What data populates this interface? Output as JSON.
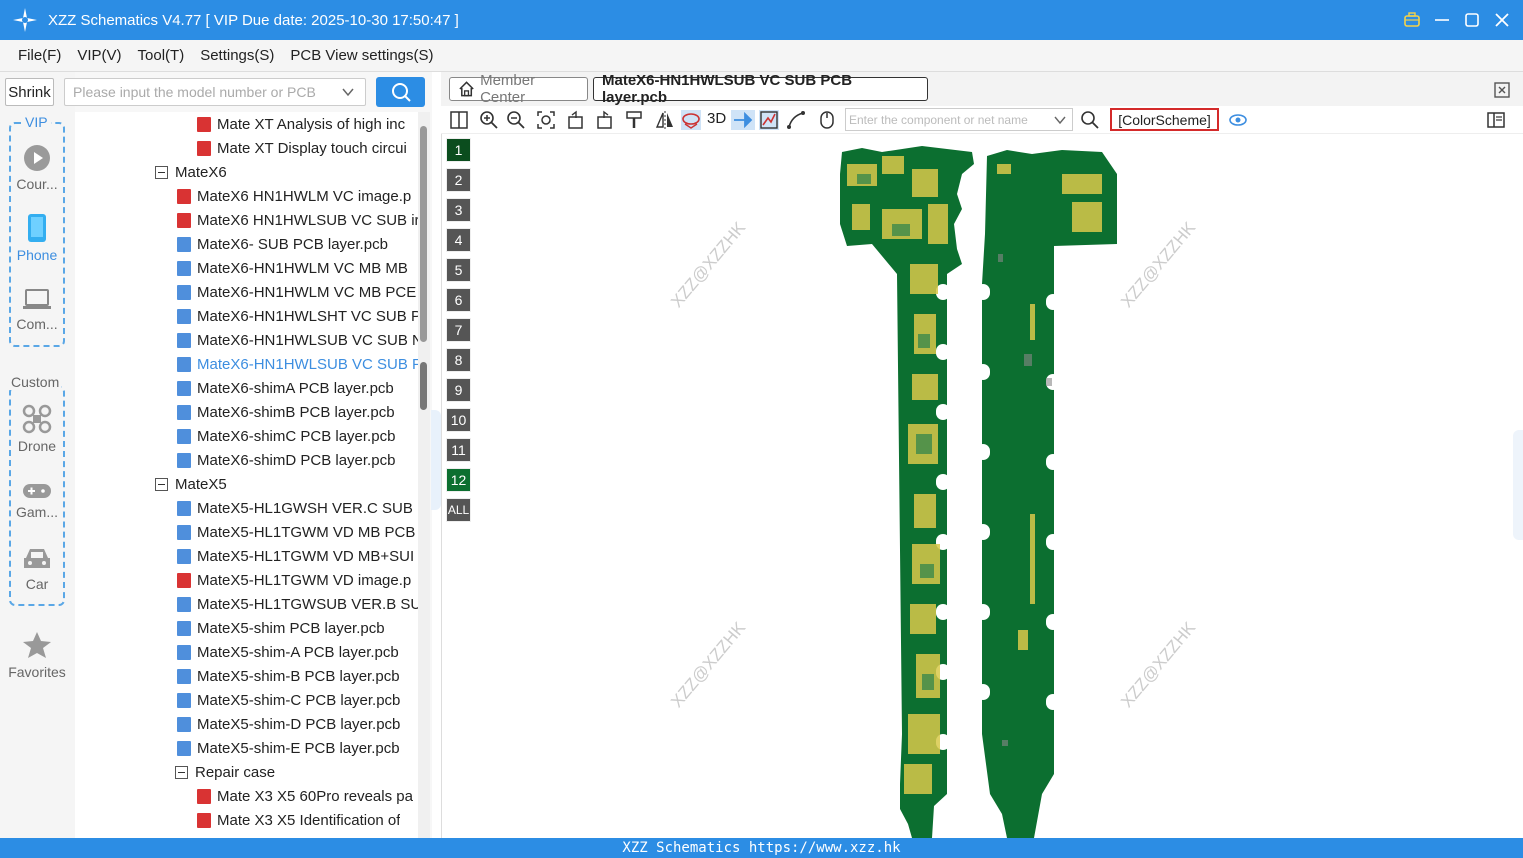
{
  "titlebar": {
    "title": "XZZ Schematics V4.77 [ VIP Due date: 2025-10-30 17:50:47 ]"
  },
  "menu": [
    "File(F)",
    "VIP(V)",
    "Tool(T)",
    "Settings(S)",
    "PCB View settings(S)"
  ],
  "left": {
    "shrink_label": "Shrink",
    "search_placeholder": "Please input the model number or PCB"
  },
  "sidebar": {
    "vip_label": "VIP",
    "custom_label": "Custom",
    "items": [
      {
        "label": "Cour...",
        "icon": "play-icon"
      },
      {
        "label": "Phone",
        "icon": "phone-icon"
      },
      {
        "label": "Com...",
        "icon": "laptop-icon"
      },
      {
        "label": "Drone",
        "icon": "drone-icon"
      },
      {
        "label": "Gam...",
        "icon": "gamepad-icon"
      },
      {
        "label": "Car",
        "icon": "car-icon"
      },
      {
        "label": "Favorites",
        "icon": "star-icon"
      }
    ]
  },
  "tree": [
    {
      "label": "Mate XT Analysis of high inc",
      "type": "pdf",
      "level": 2
    },
    {
      "label": "Mate XT Display touch circui",
      "type": "pdf",
      "level": 2
    },
    {
      "label": "MateX6",
      "type": "folder",
      "level": 0
    },
    {
      "label": "MateX6 HN1HWLM VC image.p",
      "type": "pdf",
      "level": 1
    },
    {
      "label": "MateX6 HN1HWLSUB VC SUB ir",
      "type": "pdf",
      "level": 1
    },
    {
      "label": "MateX6- SUB PCB layer.pcb",
      "type": "pcb",
      "level": 1
    },
    {
      "label": "MateX6-HN1HWLM VC MB MB",
      "type": "pcb",
      "level": 1
    },
    {
      "label": "MateX6-HN1HWLM VC MB PCE",
      "type": "pcb",
      "level": 1
    },
    {
      "label": "MateX6-HN1HWLSHT VC SUB P",
      "type": "pcb",
      "level": 1
    },
    {
      "label": "MateX6-HN1HWLSUB VC SUB N",
      "type": "pcb",
      "level": 1
    },
    {
      "label": "MateX6-HN1HWLSUB VC SUB P",
      "type": "pcb",
      "level": 1,
      "selected": true
    },
    {
      "label": "MateX6-shimA PCB layer.pcb",
      "type": "pcb",
      "level": 1
    },
    {
      "label": "MateX6-shimB PCB layer.pcb",
      "type": "pcb",
      "level": 1
    },
    {
      "label": "MateX6-shimC PCB layer.pcb",
      "type": "pcb",
      "level": 1
    },
    {
      "label": "MateX6-shimD PCB layer.pcb",
      "type": "pcb",
      "level": 1
    },
    {
      "label": "MateX5",
      "type": "folder",
      "level": 0
    },
    {
      "label": "MateX5-HL1GWSH VER.C SUB P",
      "type": "pcb",
      "level": 1
    },
    {
      "label": "MateX5-HL1TGWM VD MB PCB",
      "type": "pcb",
      "level": 1
    },
    {
      "label": "MateX5-HL1TGWM VD MB+SUI",
      "type": "pcb",
      "level": 1
    },
    {
      "label": "MateX5-HL1TGWM VD image.p",
      "type": "pdf",
      "level": 1
    },
    {
      "label": "MateX5-HL1TGWSUB VER.B SUE",
      "type": "pcb",
      "level": 1
    },
    {
      "label": "MateX5-shim PCB layer.pcb",
      "type": "pcb",
      "level": 1
    },
    {
      "label": "MateX5-shim-A PCB layer.pcb",
      "type": "pcb",
      "level": 1
    },
    {
      "label": "MateX5-shim-B PCB layer.pcb",
      "type": "pcb",
      "level": 1
    },
    {
      "label": "MateX5-shim-C PCB layer.pcb",
      "type": "pcb",
      "level": 1
    },
    {
      "label": "MateX5-shim-D PCB layer.pcb",
      "type": "pcb",
      "level": 1
    },
    {
      "label": "MateX5-shim-E PCB layer.pcb",
      "type": "pcb",
      "level": 1
    },
    {
      "label": "Repair case",
      "type": "folder",
      "level": 1
    },
    {
      "label": "Mate X3 X5 60Pro reveals pa",
      "type": "pdf",
      "level": 2
    },
    {
      "label": "Mate X3 X5 Identification of",
      "type": "pdf",
      "level": 2
    }
  ],
  "tabs": {
    "member_center": "Member Center",
    "active_file": "MateX6-HN1HWLSUB VC SUB PCB layer.pcb"
  },
  "toolbar": {
    "threed_label": "3D",
    "component_placeholder": "Enter the component or net name",
    "colorscheme_label": "[ColorScheme]"
  },
  "layers": [
    "1",
    "2",
    "3",
    "4",
    "5",
    "6",
    "7",
    "8",
    "9",
    "10",
    "11",
    "12",
    "ALL"
  ],
  "watermark": "XZZ@XZZHK",
  "statusbar": "XZZ Schematics https://www.xzz.hk",
  "colors": {
    "accent": "#2c8de4",
    "pcb_green": "#0c6f30",
    "trace_yellow": "#d9c94a"
  }
}
